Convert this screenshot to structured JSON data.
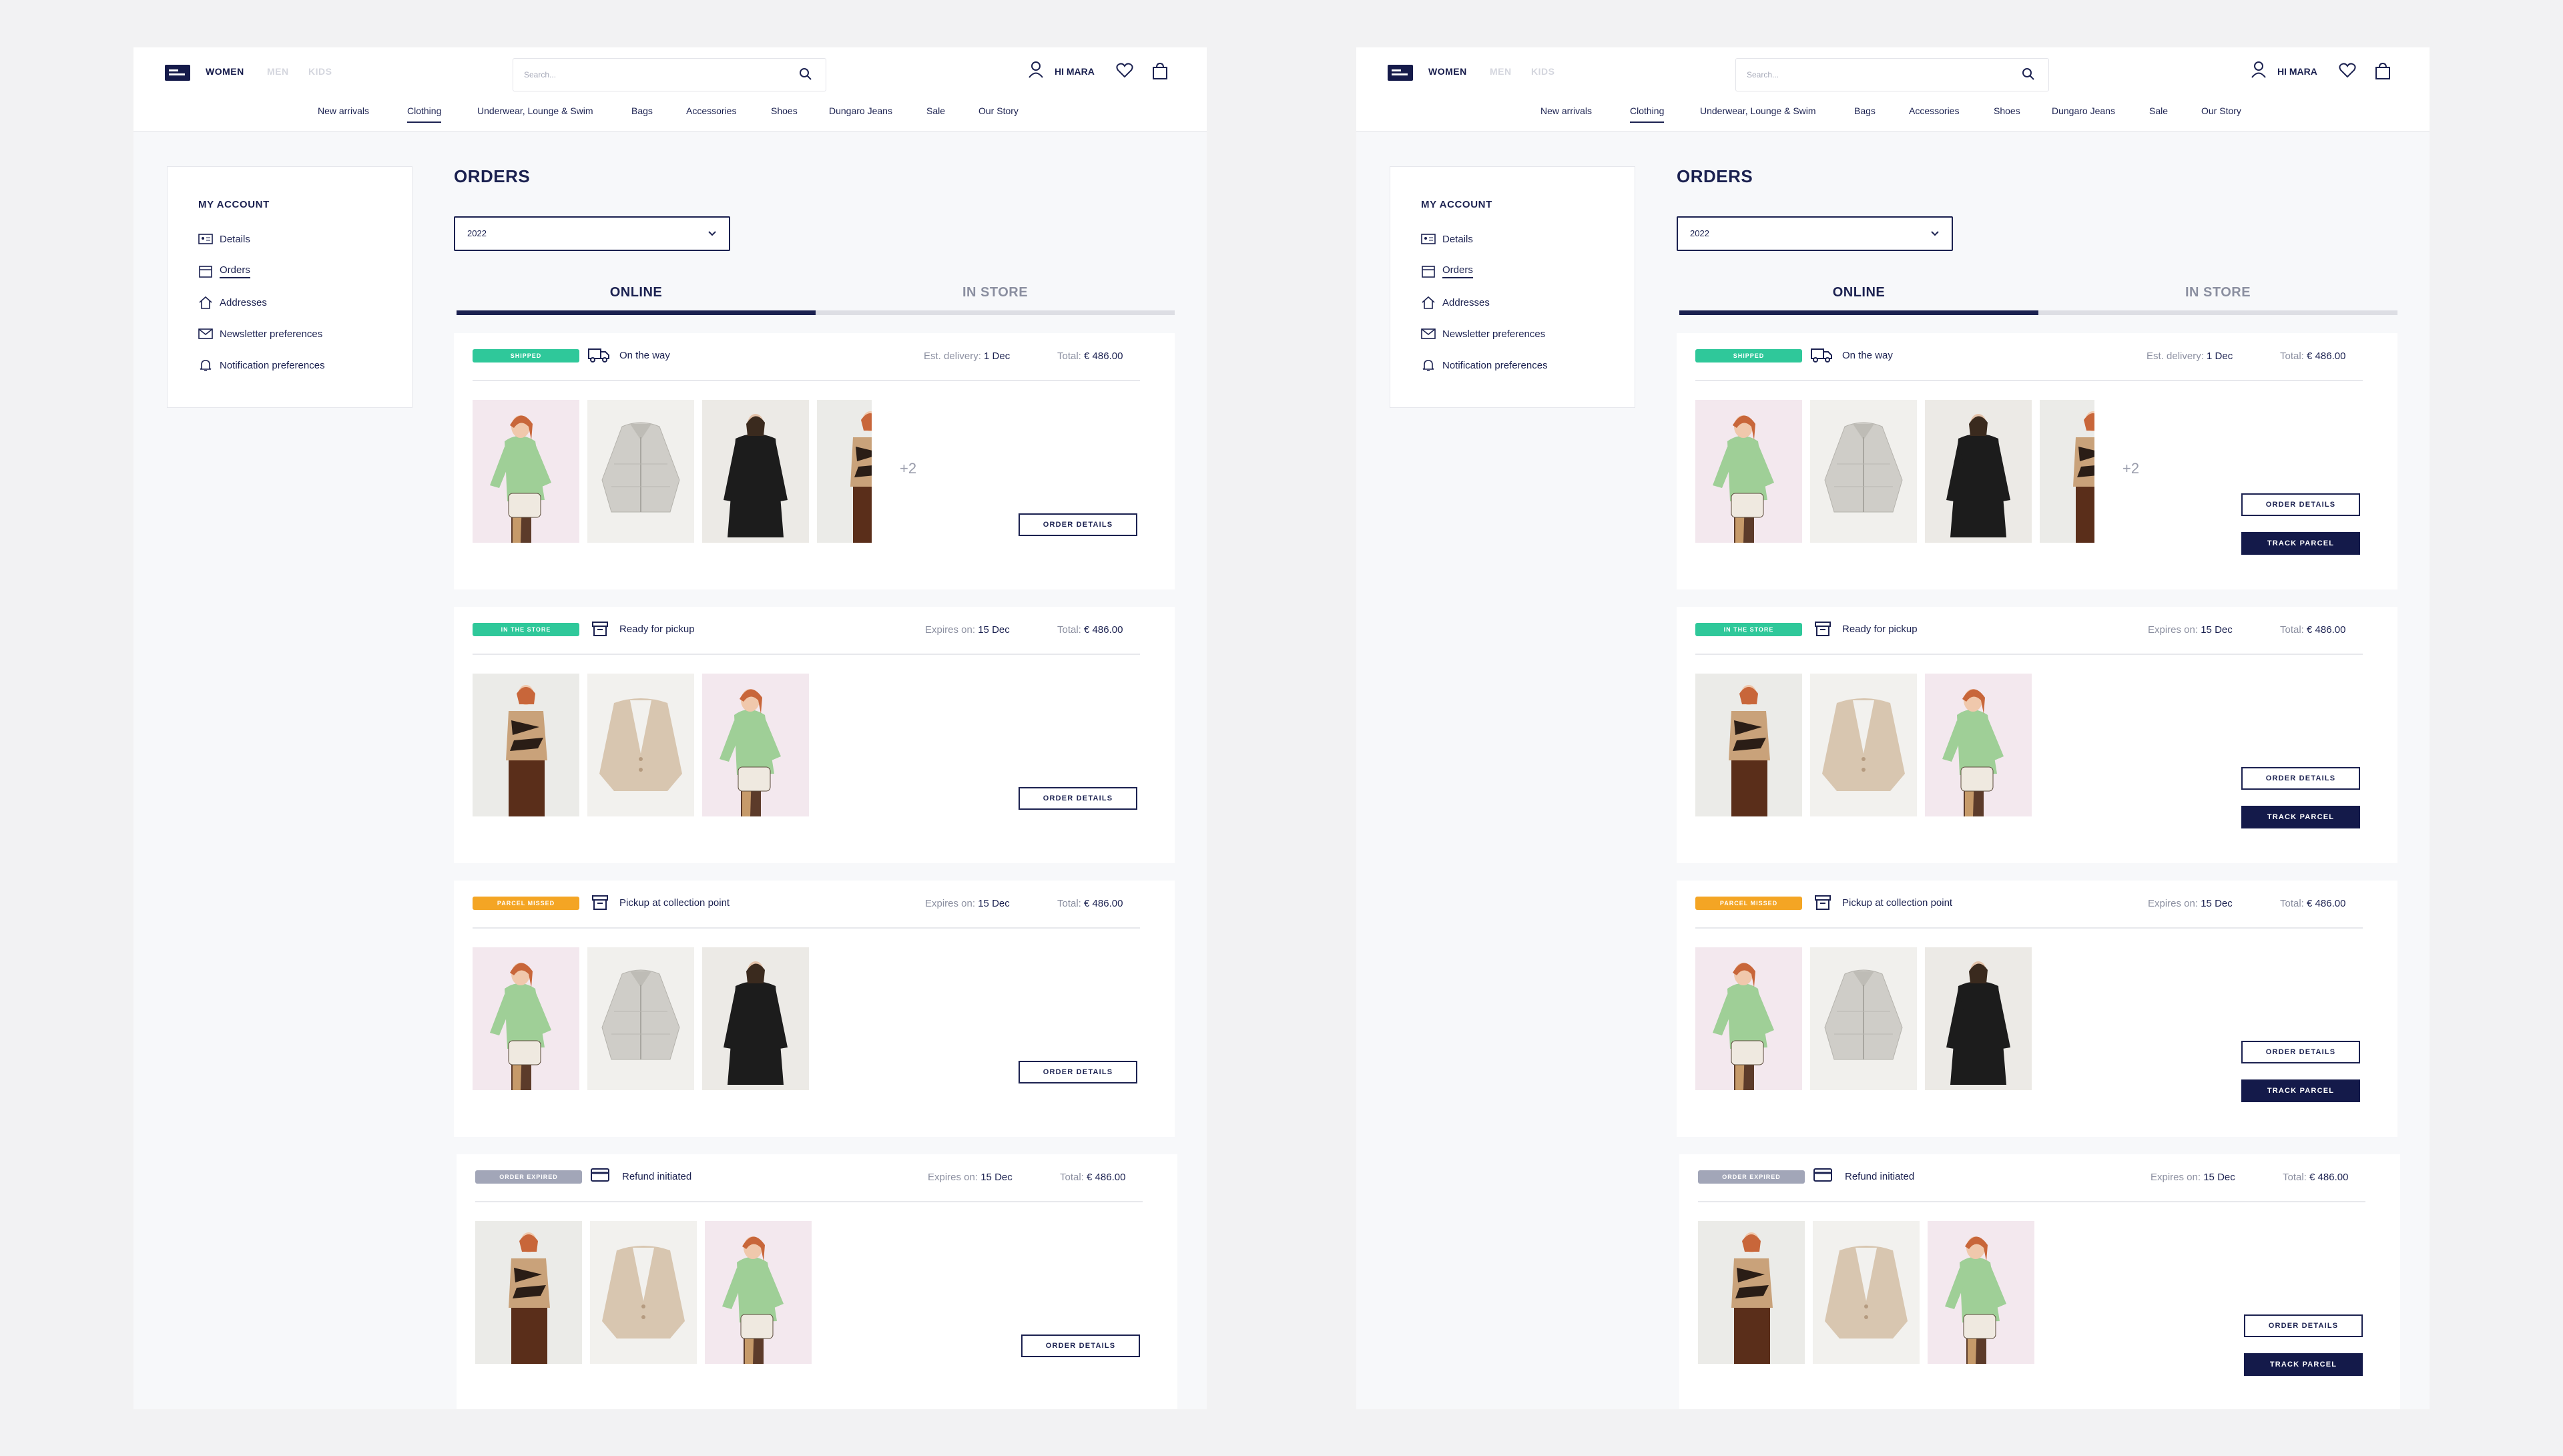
{
  "header": {
    "genders": [
      "WOMEN",
      "MEN",
      "KIDS"
    ],
    "search_placeholder": "Search...",
    "greeting": "HI MARA",
    "nav": [
      "New arrivals",
      "Clothing",
      "Underwear, Lounge & Swim",
      "Bags",
      "Accessories",
      "Shoes",
      "Dungaro Jeans",
      "Sale",
      "Our Story"
    ]
  },
  "account": {
    "title": "MY ACCOUNT",
    "items": [
      "Details",
      "Orders",
      "Addresses",
      "Newsletter preferences",
      "Notification preferences"
    ]
  },
  "orders": {
    "title": "ORDERS",
    "year": "2022",
    "tabs": [
      "ONLINE",
      "IN STORE"
    ],
    "list": [
      {
        "badge": "SHIPPED",
        "status": "On the way",
        "meta_label": "Est. delivery:",
        "meta_value": "1 Dec",
        "total_label": "Total:",
        "total": "€ 486.00",
        "more": "+2"
      },
      {
        "badge": "IN THE STORE",
        "status": "Ready for pickup",
        "meta_label": "Expires on:",
        "meta_value": "15 Dec",
        "total_label": "Total:",
        "total": "€ 486.00"
      },
      {
        "badge": "PARCEL MISSED",
        "status": "Pickup at collection point",
        "meta_label": "Expires on:",
        "meta_value": "15 Dec",
        "total_label": "Total:",
        "total": "€ 486.00"
      },
      {
        "badge": "ORDER EXPIRED",
        "status": "Refund initiated",
        "meta_label": "Expires on:",
        "meta_value": "15 Dec",
        "total_label": "Total:",
        "total": "€ 486.00"
      }
    ],
    "order_details_label": "ORDER DETAILS",
    "track_parcel_label": "TRACK PARCEL"
  },
  "colors": {
    "navy": "#1b2150",
    "green": "#2fc89a",
    "orange": "#f4a524",
    "grey": "#a2a6b8"
  }
}
